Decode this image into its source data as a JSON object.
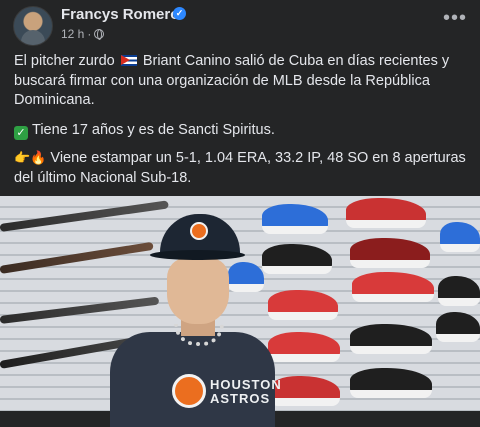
{
  "post": {
    "author": "Francys Romero",
    "time": "12 h",
    "separator": "·",
    "paragraphs": {
      "p1_a": "El pitcher zurdo",
      "p1_b": "Briant Canino salió de Cuba en días recientes y buscará firmar con una organización de MLB desde la República Dominicana.",
      "p2": "Tiene 17 años y es de Sancti Spiritus.",
      "p3": "Viene estampar un 5-1, 1.04 ERA, 33.2 IP, 48 SO en 8 aperturas del último Nacional Sub-18."
    },
    "photo": {
      "shirt_text_1": "HOUSTON",
      "shirt_text_2": "ASTROS"
    }
  },
  "icons": {
    "verified": "verified-badge-icon",
    "privacy": "globe-icon",
    "more": "more-options-icon",
    "flag": "cuba-flag-icon",
    "check": "check-mark-icon",
    "pointing": "pointing-hand-icon",
    "fire": "fire-icon"
  },
  "colors": {
    "background": "#242526",
    "text": "#e4e6eb",
    "secondary_text": "#b0b3b8",
    "verified": "#2d88ff",
    "check": "#2ea043"
  }
}
